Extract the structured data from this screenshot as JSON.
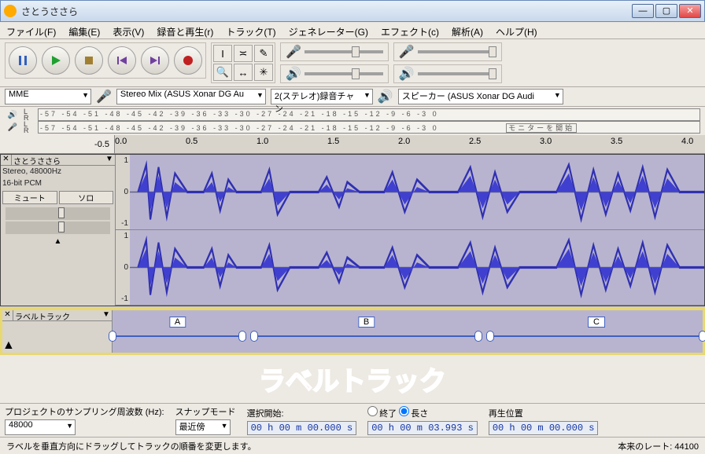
{
  "window": {
    "title": "さとうささら"
  },
  "menu": {
    "file": "ファイル(F)",
    "edit": "編集(E)",
    "view": "表示(V)",
    "rec": "録音と再生(r)",
    "track": "トラック(T)",
    "gen": "ジェネレーター(G)",
    "effect": "エフェクト(c)",
    "analyze": "解析(A)",
    "help": "ヘルプ(H)"
  },
  "device": {
    "host": "MME",
    "rec": "Stereo Mix (ASUS Xonar DG Au",
    "chan": "2(ステレオ)録音チャン",
    "play": "スピーカー (ASUS Xonar DG Audi"
  },
  "meter": {
    "scale": "-57 -54 -51 -48 -45 -42 -39 -36 -33 -30 -27 -24 -21 -18 -15 -12 -9 -6 -3  0",
    "monitor_hint": "モニターを開始"
  },
  "timeline": {
    "start": "-0.5",
    "ticks": [
      "0.0",
      "0.5",
      "1.0",
      "1.5",
      "2.0",
      "2.5",
      "3.0",
      "3.5",
      "4.0"
    ]
  },
  "audio_track": {
    "name": "さとうささら",
    "format1": "Stereo, 48000Hz",
    "format2": "16-bit PCM",
    "mute": "ミュート",
    "solo": "ソロ",
    "axis": [
      "1",
      "0",
      "-1"
    ]
  },
  "label_track": {
    "name": "ラベルトラック",
    "labels": [
      {
        "text": "A",
        "left_pct": 0,
        "width_pct": 22
      },
      {
        "text": "B",
        "left_pct": 24,
        "width_pct": 38
      },
      {
        "text": "C",
        "left_pct": 64,
        "width_pct": 36
      }
    ]
  },
  "annotation": "ラベルトラック",
  "bottom": {
    "rate_label": "プロジェクトのサンプリング周波数 (Hz):",
    "rate": "48000",
    "snap_label": "スナップモード",
    "snap": "最近傍",
    "sel_start_label": "選択開始:",
    "end_label": "終了",
    "len_label": "長さ",
    "t1": "00 h 00 m 00.000 s",
    "t2": "00 h 00 m 03.993 s",
    "pos_label": "再生位置",
    "pos": "00 h 00 m 00.000 s"
  },
  "status": {
    "msg": "ラベルを垂直方向にドラッグしてトラックの順番を変更します。",
    "rate": "本来のレート: 44100"
  }
}
